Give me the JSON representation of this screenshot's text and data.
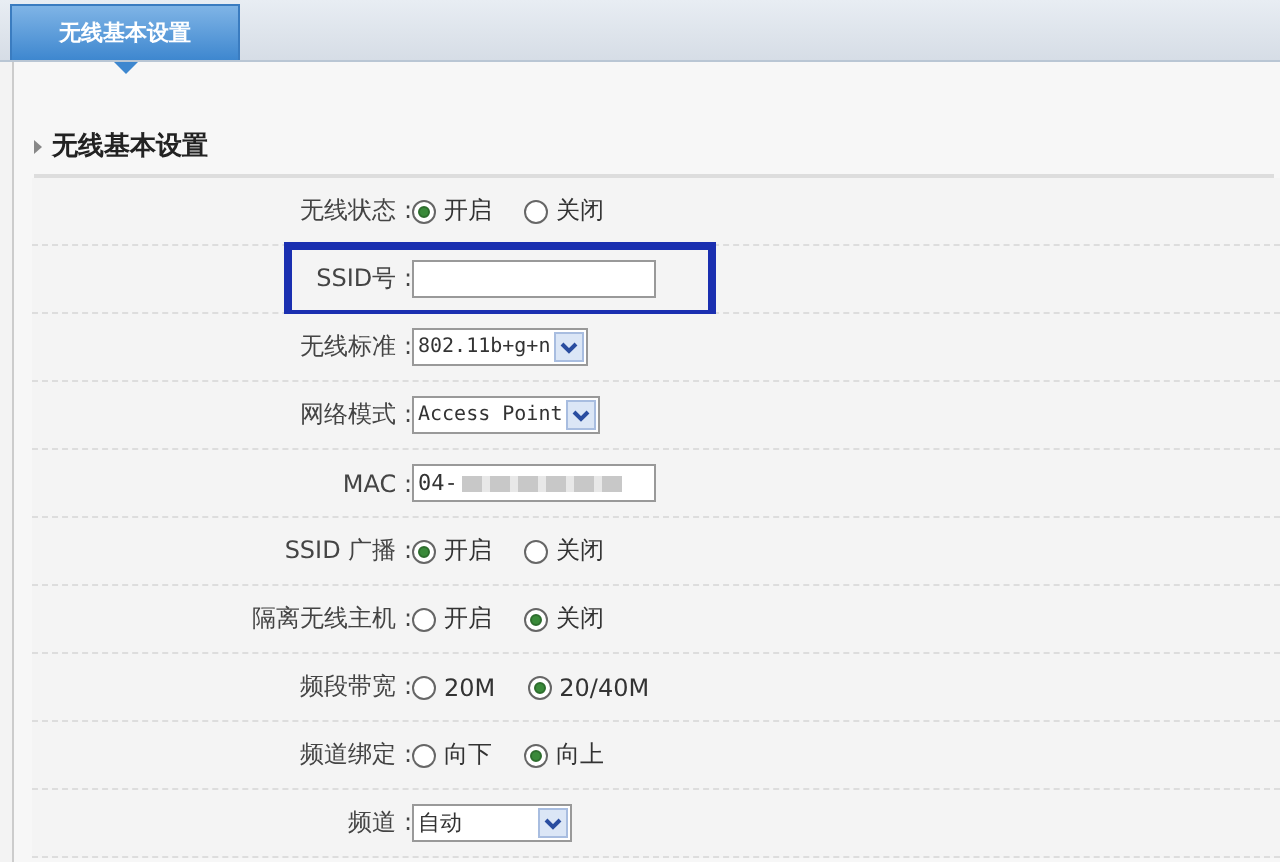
{
  "tab": {
    "label": "无线基本设置",
    "selected": true
  },
  "section": {
    "title": "无线基本设置"
  },
  "rows": [
    {
      "kind": "radio",
      "label": "无线状态 :",
      "options": [
        {
          "label": "开启",
          "selected": true
        },
        {
          "label": "关闭",
          "selected": false
        }
      ]
    },
    {
      "kind": "text",
      "label": "SSID号 :",
      "value": "",
      "highlighted": true
    },
    {
      "kind": "select",
      "label": "无线标准 :",
      "value": "802.11b+g+n",
      "mono": true
    },
    {
      "kind": "select",
      "label": "网络模式 :",
      "value": "Access Point",
      "mono": true
    },
    {
      "kind": "text",
      "label": "MAC :",
      "value": "04-",
      "blurred": true
    },
    {
      "kind": "radio",
      "label": "SSID 广播 :",
      "options": [
        {
          "label": "开启",
          "selected": true
        },
        {
          "label": "关闭",
          "selected": false
        }
      ]
    },
    {
      "kind": "radio",
      "label": "隔离无线主机 :",
      "options": [
        {
          "label": "开启",
          "selected": false
        },
        {
          "label": "关闭",
          "selected": true
        }
      ]
    },
    {
      "kind": "radio",
      "label": "频段带宽 :",
      "options": [
        {
          "label": "20M",
          "selected": false
        },
        {
          "label": "20/40M",
          "selected": true
        }
      ]
    },
    {
      "kind": "radio",
      "label": "频道绑定 :",
      "options": [
        {
          "label": "向下",
          "selected": false
        },
        {
          "label": "向上",
          "selected": true
        }
      ]
    },
    {
      "kind": "select",
      "label": "频道 :",
      "value": "自动",
      "mono": false
    }
  ]
}
